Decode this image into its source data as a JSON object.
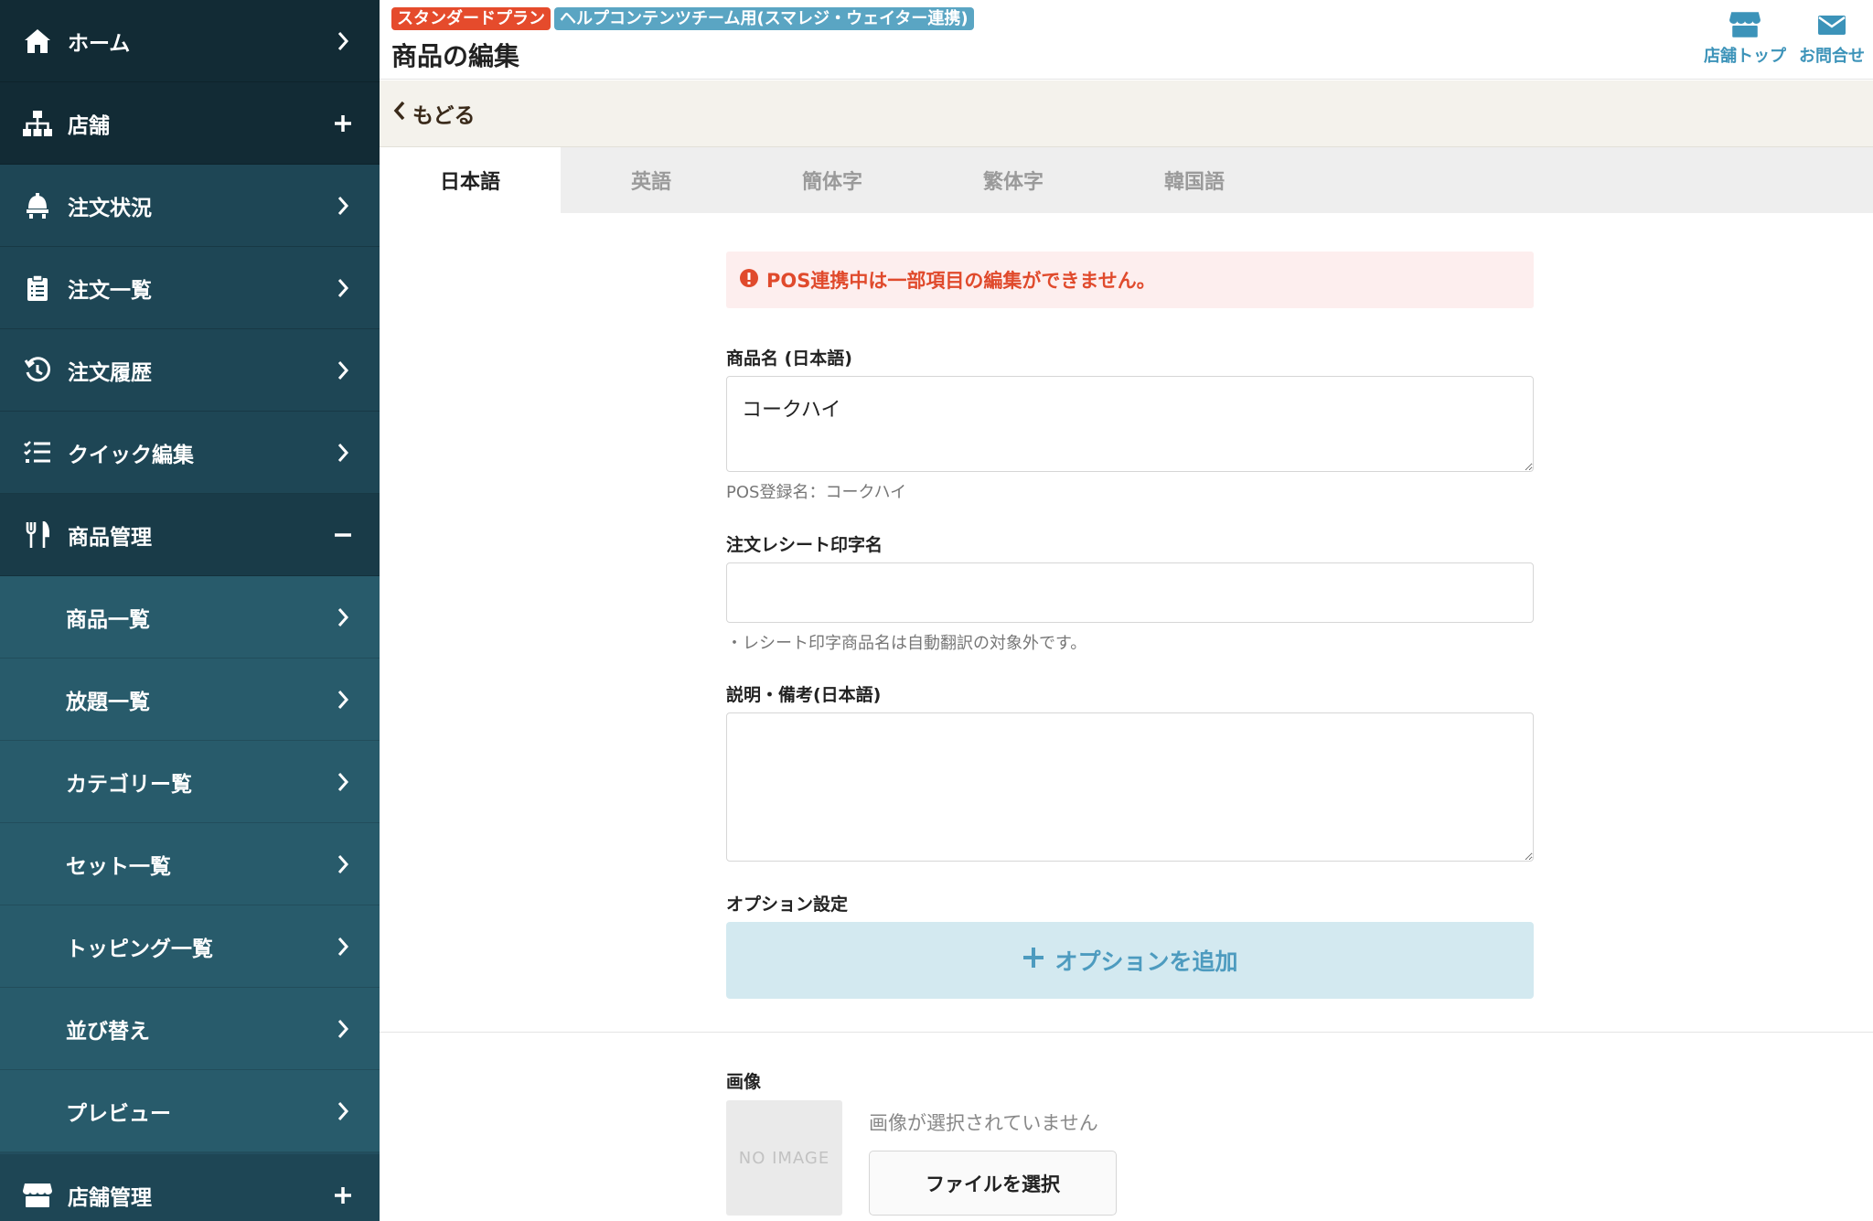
{
  "sidebar": {
    "items": [
      {
        "label": "ホーム",
        "icon": "home-icon",
        "right": "chevron"
      },
      {
        "label": "店舗",
        "icon": "sitemap-icon",
        "right": "plus"
      },
      {
        "label": "注文状況",
        "icon": "bell-icon",
        "right": "chevron"
      },
      {
        "label": "注文一覧",
        "icon": "clipboard-icon",
        "right": "chevron"
      },
      {
        "label": "注文履歴",
        "icon": "history-icon",
        "right": "chevron"
      },
      {
        "label": "クイック編集",
        "icon": "list-check-icon",
        "right": "chevron"
      },
      {
        "label": "商品管理",
        "icon": "utensils-icon",
        "right": "minus"
      },
      {
        "label": "商品一覧",
        "right": "chevron"
      },
      {
        "label": "放題一覧",
        "right": "chevron"
      },
      {
        "label": "カテゴリー覧",
        "right": "chevron"
      },
      {
        "label": "セット一覧",
        "right": "chevron"
      },
      {
        "label": "トッピング一覧",
        "right": "chevron"
      },
      {
        "label": "並び替え",
        "right": "chevron"
      },
      {
        "label": "プレビュー",
        "right": "chevron"
      },
      {
        "label": "店舗管理",
        "icon": "store-icon",
        "right": "plus"
      }
    ]
  },
  "header": {
    "plan_badge": "スタンダードプラン",
    "store_badge": "ヘルプコンテンツチーム用(スマレジ・ウェイター連携)",
    "title": "商品の編集",
    "store_top_label": "店舗トップ",
    "contact_label": "お問合せ"
  },
  "backbar": {
    "back_label": "もどる"
  },
  "tabs": [
    {
      "label": "日本語",
      "active": true
    },
    {
      "label": "英語"
    },
    {
      "label": "簡体字"
    },
    {
      "label": "繁体字"
    },
    {
      "label": "韓国語"
    }
  ],
  "form": {
    "alert": "POS連携中は一部項目の編集ができません。",
    "name_label": "商品名 (日本語)",
    "name_value": "コークハイ",
    "pos_name_help": "POS登録名：コークハイ",
    "receipt_label": "注文レシート印字名",
    "receipt_value": "",
    "receipt_help": "・レシート印字商品名は自動翻訳の対象外です。",
    "description_label": "説明・備考(日本語)",
    "description_value": "",
    "option_label": "オプション設定",
    "add_option_label": "オプションを追加",
    "image_label": "画像",
    "no_image_text": "NO IMAGE",
    "file_status": "画像が選択されていません",
    "file_button": "ファイルを選択"
  },
  "colors": {
    "sidebar_bg": "#234e5f",
    "plan_badge": "#e54b2c",
    "store_badge": "#5aa5c3",
    "accent": "#3c93b9",
    "alert_text": "#e04a2c"
  }
}
